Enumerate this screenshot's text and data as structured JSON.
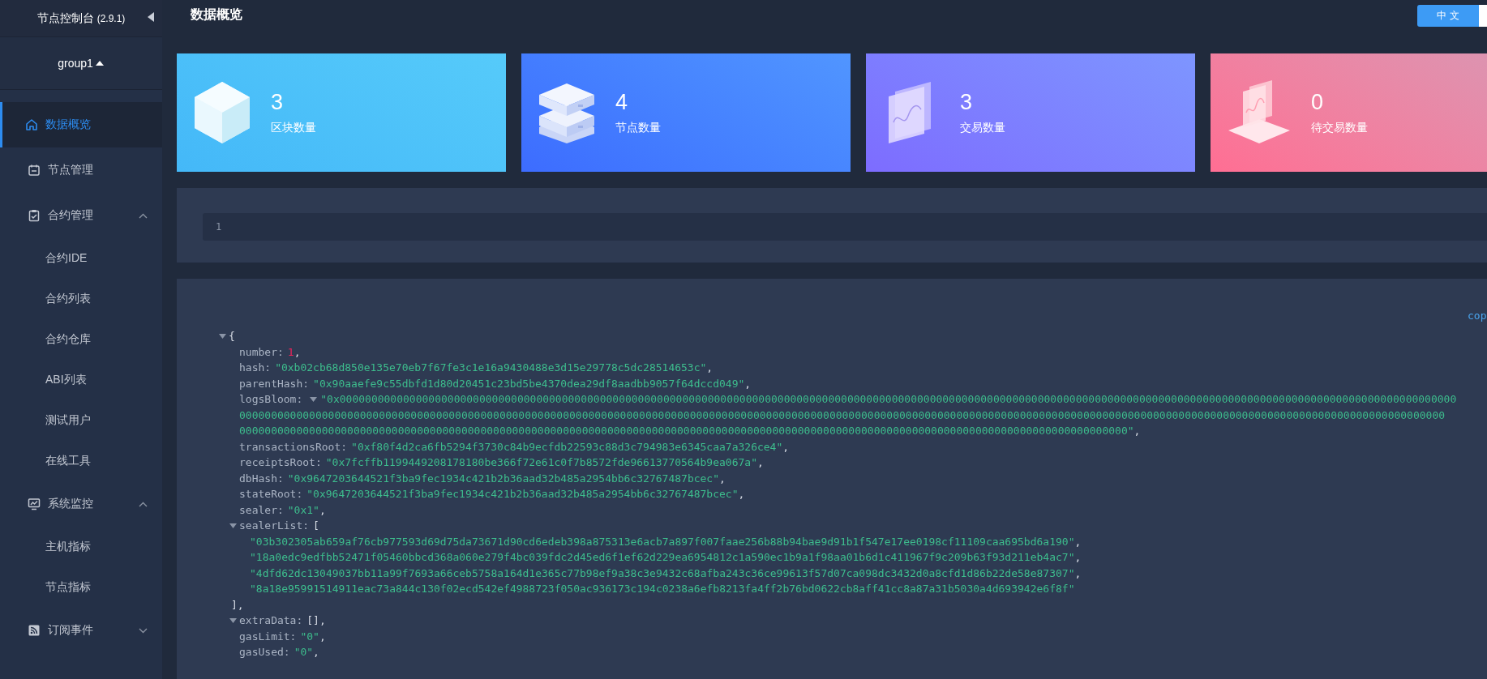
{
  "sidebar": {
    "title": "节点控制台",
    "version": "(2.9.1)",
    "group": "group1",
    "items": [
      {
        "label": "数据概览",
        "selected": true
      },
      {
        "label": "节点管理",
        "selected": false
      },
      {
        "label": "合约管理",
        "selected": false,
        "expanded": true,
        "children": [
          {
            "label": "合约IDE",
            "selected": false
          },
          {
            "label": "合约列表",
            "selected": false
          },
          {
            "label": "合约仓库",
            "selected": false
          },
          {
            "label": "ABI列表",
            "selected": false
          },
          {
            "label": "测试用户",
            "selected": false
          },
          {
            "label": "在线工具",
            "selected": false
          }
        ]
      },
      {
        "label": "系统监控",
        "selected": false,
        "expanded": true,
        "children": [
          {
            "label": "主机指标",
            "selected": false
          },
          {
            "label": "节点指标",
            "selected": false
          }
        ]
      },
      {
        "label": "订阅事件",
        "selected": false,
        "expanded": false
      }
    ]
  },
  "header": {
    "title": "数据概览",
    "language": "中 文"
  },
  "cards": [
    {
      "value": "3",
      "label": "区块数量",
      "color": "#44b8f8"
    },
    {
      "value": "4",
      "label": "节点数量",
      "color": "#3d6cff"
    },
    {
      "value": "3",
      "label": "交易数量",
      "color": "#7d6cff"
    },
    {
      "value": "0",
      "label": "待交易数量",
      "color": "#ff6e93"
    }
  ],
  "editor": {
    "line_numbers": [
      "1"
    ]
  },
  "json_view": {
    "copy_label": "cop",
    "root": {
      "open": "{",
      "expanded": true,
      "fields": [
        {
          "key": "number:",
          "kind": "number",
          "value": "1",
          "after": ","
        },
        {
          "key": "hash:",
          "kind": "string",
          "value": "\"0xb02cb68d850e135e70eb7f67fe3c1e16a9430488e3d15e29778c5dc28514653c\"",
          "after": ","
        },
        {
          "key": "parentHash:",
          "kind": "string",
          "value": "\"0x90aaefe9c55dbfd1d80d20451c23bd5be4370dea29df8aadbb9057f64dccd049\"",
          "after": ","
        },
        {
          "key": "logsBloom:",
          "kind": "string",
          "expanded": true,
          "after": ",",
          "lines": [
            "\"0x00000000000000000000000000000000000000000000000000000000000000000000000000000000000000000000000000000000000000000000000000000000000000000000000000000000000000000000000000000000",
            "0000000000000000000000000000000000000000000000000000000000000000000000000000000000000000000000000000000000000000000000000000000000000000000000000000000000000000000000000000000000000000000000",
            "00000000000000000000000000000000000000000000000000000000000000000000000000000000000000000000000000000000000000000000000000000000000000000000\""
          ]
        },
        {
          "key": "transactionsRoot:",
          "kind": "string",
          "value": "\"0xf80f4d2ca6fb5294f3730c84b9ecfdb22593c88d3c794983e6345caa7a326ce4\"",
          "after": ","
        },
        {
          "key": "receiptsRoot:",
          "kind": "string",
          "value": "\"0x7fcffb1199449208178180be366f72e61c0f7b8572fde96613770564b9ea067a\"",
          "after": ","
        },
        {
          "key": "dbHash:",
          "kind": "string",
          "value": "\"0x9647203644521f3ba9fec1934c421b2b36aad32b485a2954bb6c32767487bcec\"",
          "after": ","
        },
        {
          "key": "stateRoot:",
          "kind": "string",
          "value": "\"0x9647203644521f3ba9fec1934c421b2b36aad32b485a2954bb6c32767487bcec\"",
          "after": ","
        },
        {
          "key": "sealer:",
          "kind": "string",
          "value": "\"0x1\"",
          "after": ","
        },
        {
          "key": "sealerList:",
          "kind": "array",
          "expanded": true,
          "open": "[",
          "close": "],",
          "items": [
            {
              "value": "\"03b302305ab659af76cb977593d69d75da73671d90cd6edeb398a875313e6acb7a897f007faae256b88b94bae9d91b1f547e17ee0198cf11109caa695bd6a190\"",
              "after": ","
            },
            {
              "value": "\"18a0edc9edfbb52471f05460bbcd368a060e279f4bc039fdc2d45ed6f1ef62d229ea6954812c1a590ec1b9a1f98aa01b6d1c411967f9c209b63f93d211eb4ac7\"",
              "after": ","
            },
            {
              "value": "\"4dfd62dc13049037bb11a99f7693a66ceb5758a164d1e365c77b98ef9a38c3e9432c68afba243c36ce99613f57d07ca098dc3432d0a8cfd1d86b22de58e87307\"",
              "after": ","
            },
            {
              "value": "\"8a18e95991514911eac73a844c130f02ecd542ef4988723f050ac936173c194c0238a6efb8213fa4ff2b76bd0622cb8aff41cc8a87a31b5030a4d693942e6f8f\""
            }
          ]
        },
        {
          "key": "extraData:",
          "kind": "array",
          "expanded": true,
          "open": "[]",
          "after": ","
        },
        {
          "key": "gasLimit:",
          "kind": "string",
          "value": "\"0\"",
          "after": ","
        },
        {
          "key": "gasUsed:",
          "kind": "string",
          "value": "\"0\"",
          "after": ","
        }
      ]
    }
  }
}
